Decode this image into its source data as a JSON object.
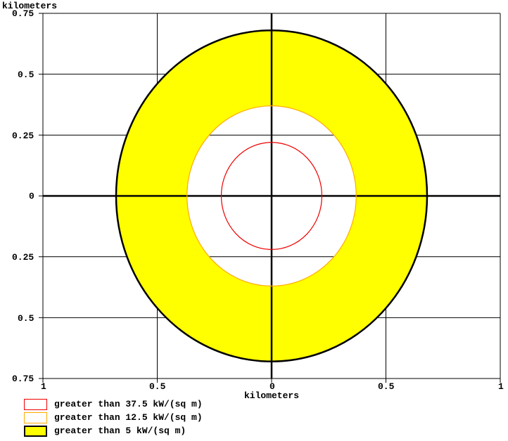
{
  "chart_data": {
    "type": "other",
    "title": "",
    "xlabel": "kilometers",
    "ylabel": "kilometers",
    "xlim": [
      -1,
      1
    ],
    "ylim": [
      -0.75,
      0.75
    ],
    "x_ticks": [
      "1",
      "0.5",
      "0",
      "0.5",
      "1"
    ],
    "y_ticks": [
      "0.75",
      "0.5",
      "0.25",
      "0",
      "0.25",
      "0.5",
      "0.75"
    ],
    "x_tick_values": [
      -1,
      -0.5,
      0,
      0.5,
      1
    ],
    "y_tick_values": [
      0.75,
      0.5,
      0.25,
      0,
      -0.25,
      -0.5,
      -0.75
    ],
    "center": [
      0,
      0
    ],
    "zones": [
      {
        "name": "inner",
        "radius_km": 0.22,
        "threshold": "greater than 37.5 kW/(sq m)",
        "stroke": "#ee0000",
        "fill": "none",
        "stroke_width": 1
      },
      {
        "name": "middle",
        "radius_km": 0.37,
        "threshold": "greater than 12.5 kW/(sq m)",
        "stroke": "#ffaa00",
        "fill": "none",
        "stroke_width": 1
      },
      {
        "name": "outer",
        "radius_km": 0.68,
        "threshold": "greater than 5 kW/(sq m)",
        "stroke": "#000000",
        "fill": "#ffff00",
        "stroke_width": 2,
        "fill_note": "annulus between middle ring and outer ring"
      }
    ]
  },
  "axes": {
    "xlabel": "kilometers",
    "ylabel": "kilometers"
  },
  "x_ticks": {
    "t0": "1",
    "t1": "0.5",
    "t2": "0",
    "t3": "0.5",
    "t4": "1"
  },
  "y_ticks": {
    "t0": "0.75",
    "t1": "0.5",
    "t2": "0.25",
    "t3": "0",
    "t4": "0.25",
    "t5": "0.5",
    "t6": "0.75"
  },
  "legend": {
    "items": [
      {
        "label": "greater than 37.5 kW/(sq m)",
        "swatch": "red"
      },
      {
        "label": "greater than 12.5 kW/(sq m)",
        "swatch": "orange"
      },
      {
        "label": "greater than 5 kW/(sq m)",
        "swatch": "yellow"
      }
    ]
  }
}
